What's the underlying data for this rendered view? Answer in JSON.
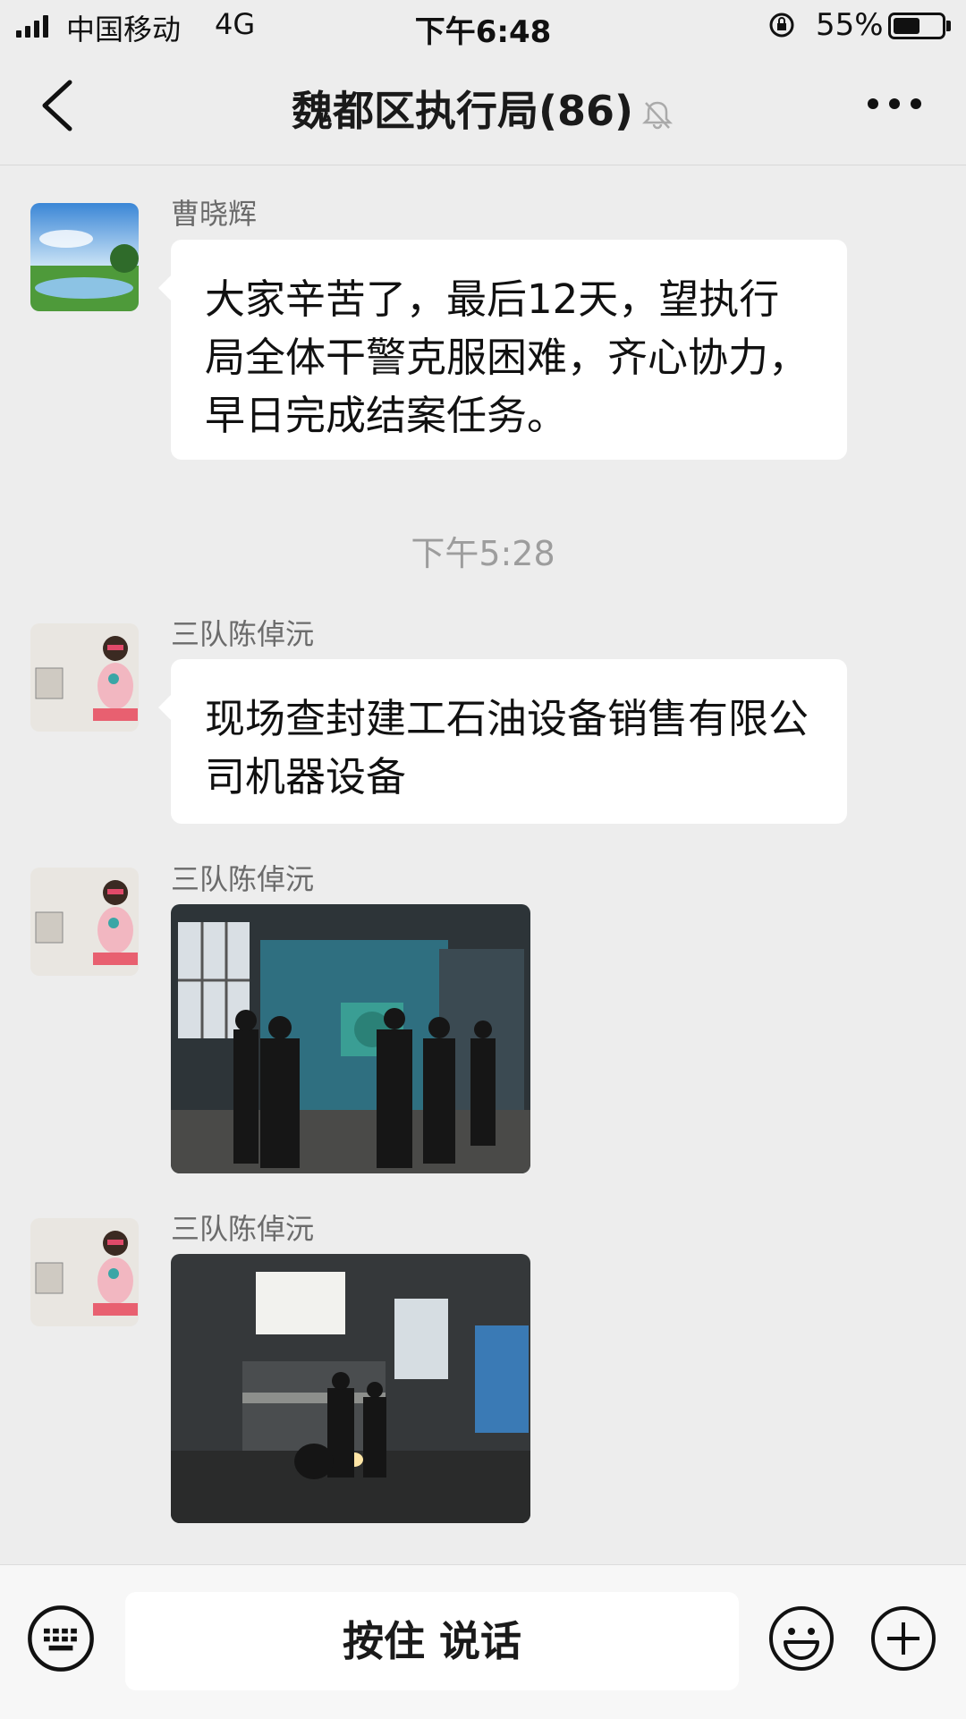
{
  "status_bar": {
    "carrier": "中国移动",
    "network": "4G",
    "time": "下午6:48",
    "battery": "55%",
    "battery_level": 0.55
  },
  "nav": {
    "title": "魏都区执行局(86)",
    "muted": true
  },
  "messages": [
    {
      "sender": "曹晓辉",
      "type": "text",
      "text": "大家辛苦了，最后12天，望执行局全体干警克服困难，齐心协力，早日完成结案任务。"
    },
    {
      "sender": "三队陈倬沅",
      "type": "text",
      "text": "现场查封建工石油设备销售有限公司机器设备"
    },
    {
      "sender": "三队陈倬沅",
      "type": "image",
      "description": "factory-inspection-photo"
    },
    {
      "sender": "三队陈倬沅",
      "type": "image",
      "description": "machine-seizure-photo"
    }
  ],
  "timestamp": "下午5:28",
  "input_bar": {
    "hold_to_talk": "按住 说话"
  },
  "icons": {
    "keyboard": "keyboard-icon",
    "emoji": "emoji-icon",
    "plus": "plus-icon",
    "back": "back-arrow-icon",
    "more": "more-icon",
    "mute": "mute-bell-icon"
  }
}
